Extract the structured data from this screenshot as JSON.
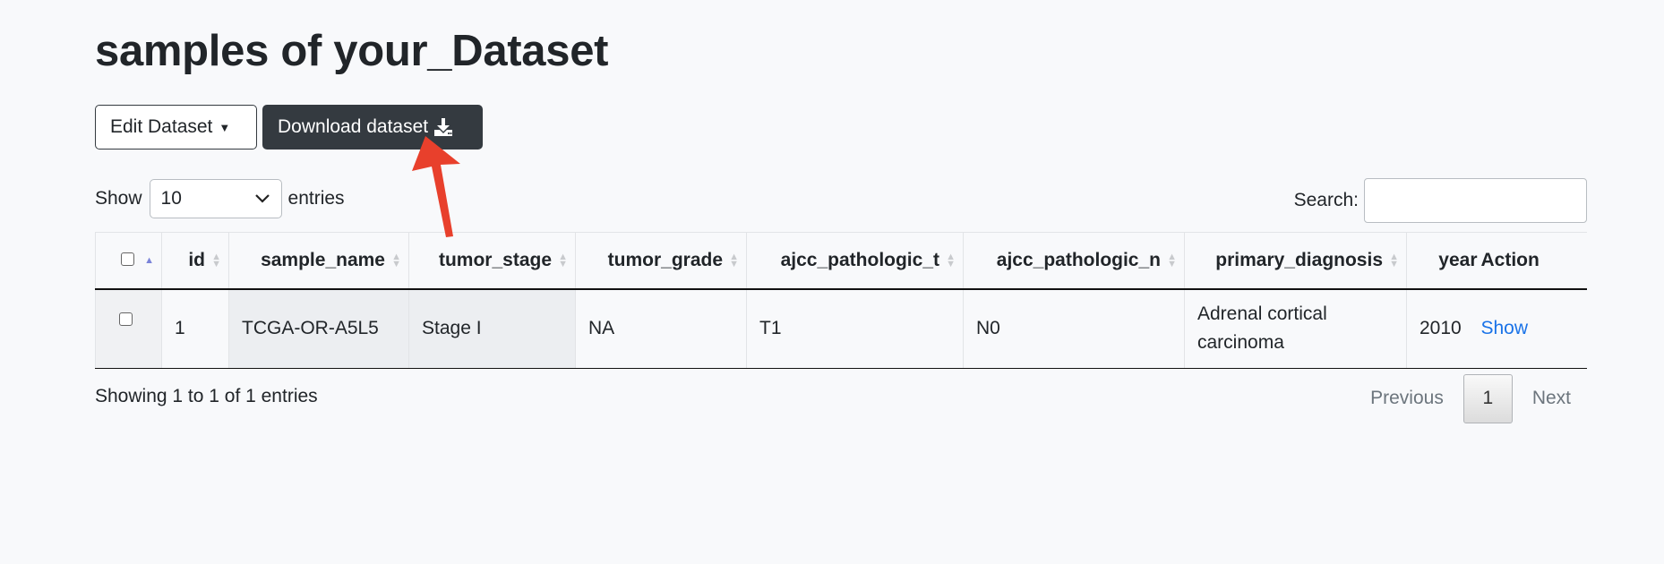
{
  "page": {
    "title": "samples of your_Dataset"
  },
  "toolbar": {
    "edit_label": "Edit Dataset",
    "download_label": "Download dataset"
  },
  "length": {
    "prefix": "Show",
    "value": "10",
    "suffix": "entries"
  },
  "search": {
    "label": "Search:",
    "value": ""
  },
  "table": {
    "columns": [
      "id",
      "sample_name",
      "tumor_stage",
      "tumor_grade",
      "ajcc_pathologic_t",
      "ajcc_pathologic_n",
      "primary_diagnosis",
      "year",
      "Action"
    ],
    "rows": [
      {
        "id": "1",
        "sample_name": "TCGA-OR-A5L5",
        "tumor_stage": "Stage I",
        "tumor_grade": "NA",
        "ajcc_pathologic_t": "T1",
        "ajcc_pathologic_n": "N0",
        "primary_diagnosis": "Adrenal cortical carcinoma",
        "year": "2010",
        "action": "Show"
      }
    ]
  },
  "footer": {
    "info": "Showing 1 to 1 of 1 entries",
    "previous": "Previous",
    "page": "1",
    "next": "Next"
  },
  "annotation": {
    "arrow_color": "#e8402c"
  }
}
